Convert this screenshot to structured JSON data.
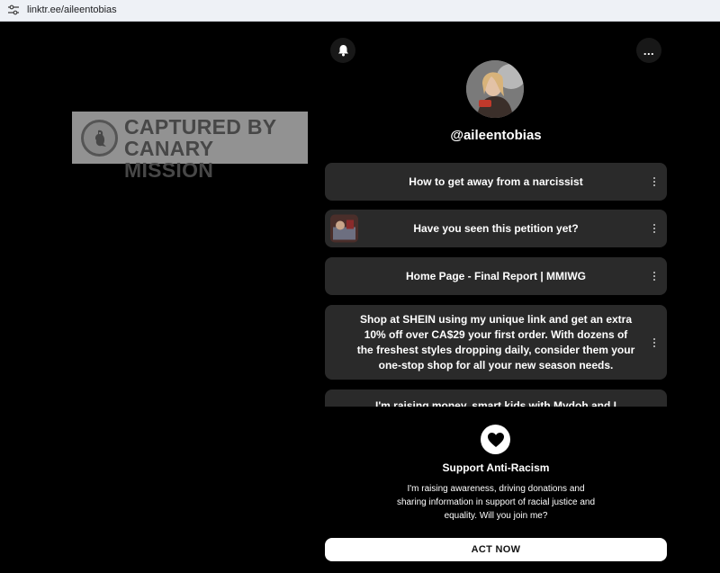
{
  "browser": {
    "url": "linktr.ee/aileentobias"
  },
  "watermark": {
    "line1": "CAPTURED BY",
    "line2": "CANARY MISSION"
  },
  "header": {
    "more_label": "..."
  },
  "profile": {
    "handle": "@aileentobias"
  },
  "links": [
    {
      "label": "How to get away from a narcissist",
      "has_thumbnail": false
    },
    {
      "label": "Have you seen this petition yet?",
      "has_thumbnail": true
    },
    {
      "label": "Home Page - Final Report | MMIWG",
      "has_thumbnail": false
    },
    {
      "label": "Shop at SHEIN using my unique link and get an extra 10% off over CA$29 your first order. With dozens of the freshest styles dropping daily, consider them your one-stop shop for all your new season needs.",
      "has_thumbnail": false
    },
    {
      "label": "I'm raising money, smart kids with Mydoh and I thought you'd",
      "has_thumbnail": false
    }
  ],
  "campaign": {
    "title": "Support Anti-Racism",
    "description": "I'm raising awareness, driving donations and sharing information in support of racial justice and equality. Will you join me?",
    "cta_label": "ACT NOW"
  },
  "icons": {
    "address_bar": "tune-icon",
    "bell": "bell-icon",
    "more": "more-horizontal-icon",
    "link_menu": "kebab-menu-icon",
    "campaign": "heart-icon"
  },
  "colors": {
    "page_background": "#000000",
    "card_background": "#2a2a2a",
    "text": "#ffffff",
    "button_background": "#ffffff"
  }
}
